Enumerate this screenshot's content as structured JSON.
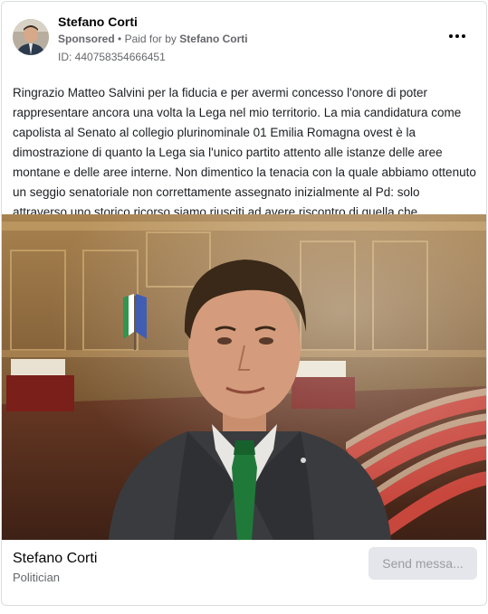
{
  "header": {
    "page_name": "Stefano Corti",
    "sponsored": "Sponsored",
    "separator": "•",
    "paid_prefix": "Paid for by",
    "paid_by": "Stefano Corti",
    "ad_id": "ID: 440758354666451",
    "more_icon": "more-horizontal-icon"
  },
  "post": {
    "text": "Ringrazio Matteo Salvini per la fiducia e per avermi concesso l'onore di poter rappresentare ancora una volta la Lega nel mio territorio. La mia candidatura come capolista al Senato al collegio plurinominale 01 Emilia Romagna ovest è la dimostrazione di quanto la Lega sia l'unico partito attento alle istanze delle aree montane e delle aree interne. Non dimentico la tenacia con la quale abbiamo ottenuto un seggio senatoriale non correttamente assegnato inizialmente al Pd: solo attraverso uno storico ricorso siamo riusciti ad avere riscontro di quella che..."
  },
  "footer": {
    "name": "Stefano Corti",
    "category": "Politician",
    "button_label": "Send messa..."
  },
  "colors": {
    "secondary_text": "#65676b",
    "button_bg": "#e4e6eb",
    "button_text": "#9a9ca2",
    "tie": "#1f7a3a",
    "suit": "#3a3b3e"
  }
}
